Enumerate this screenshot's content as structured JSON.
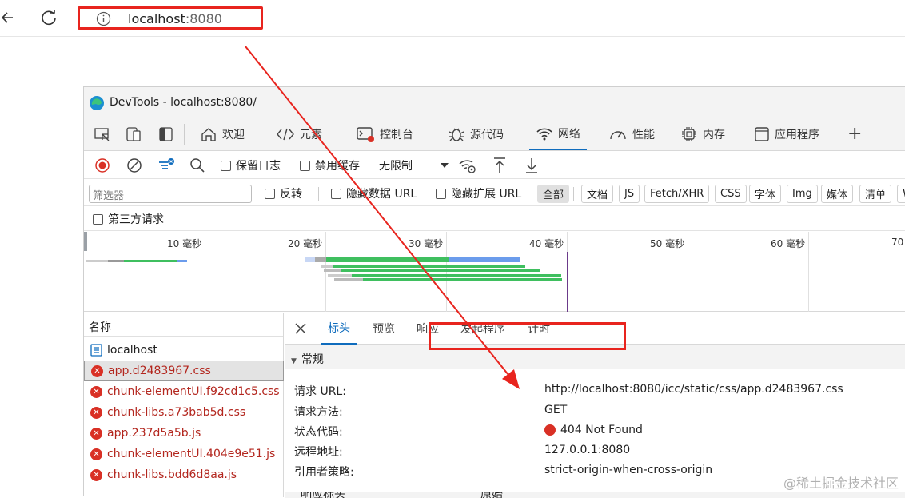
{
  "browser": {
    "address_host": "localhost",
    "address_port": ":8080",
    "back_icon": "arrow-left-icon",
    "reload_icon": "reload-icon",
    "info_icon": "info-icon",
    "highlight_color": "#e8241e"
  },
  "devtools": {
    "title": "DevTools - localhost:8080/",
    "tabs": [
      {
        "label": "欢迎",
        "icon": "home-icon"
      },
      {
        "label": "元素",
        "icon": "code-icon"
      },
      {
        "label": "控制台",
        "icon": "console-icon"
      },
      {
        "label": "源代码",
        "icon": "bug-icon"
      },
      {
        "label": "网络",
        "icon": "wifi-icon"
      },
      {
        "label": "性能",
        "icon": "gauge-icon"
      },
      {
        "label": "内存",
        "icon": "chip-icon"
      },
      {
        "label": "应用程序",
        "icon": "window-icon"
      }
    ],
    "add_tab": "+",
    "toolbar": {
      "preserve_log": "保留日志",
      "disable_cache": "禁用缓存",
      "throttling": "无限制"
    },
    "filter": {
      "placeholder": "筛选器",
      "invert": "反转",
      "hide_data_url": "隐藏数据 URL",
      "hide_ext_url": "隐藏扩展 URL",
      "types": [
        "全部",
        "文档",
        "JS",
        "Fetch/XHR",
        "CSS",
        "字体",
        "Img",
        "媒体",
        "清单",
        "W"
      ],
      "third_party": "第三方请求"
    },
    "timeline": {
      "ticks": [
        "10 毫秒",
        "20 毫秒",
        "30 毫秒",
        "40 毫秒",
        "50 毫秒",
        "60 毫秒",
        "70"
      ]
    },
    "name_pane": {
      "header": "名称",
      "requests": [
        {
          "name": "localhost",
          "status": "ok"
        },
        {
          "name": "app.d2483967.css",
          "status": "error"
        },
        {
          "name": "chunk-elementUI.f92cd1c5.css",
          "status": "error"
        },
        {
          "name": "chunk-libs.a73bab5d.css",
          "status": "error"
        },
        {
          "name": "app.237d5a5b.js",
          "status": "error"
        },
        {
          "name": "chunk-elementUI.404e9e51.js",
          "status": "error"
        },
        {
          "name": "chunk-libs.bdd6d8aa.js",
          "status": "error"
        }
      ]
    },
    "detail": {
      "tabs": [
        "标头",
        "预览",
        "响应",
        "发起程序",
        "计时"
      ],
      "section": "常规",
      "rows": [
        {
          "key": "请求 URL:",
          "value": "http://localhost:8080/icc/static/css/app.d2483967.css"
        },
        {
          "key": "请求方法:",
          "value": "GET"
        },
        {
          "key": "状态代码:",
          "value": "404 Not Found"
        },
        {
          "key": "远程地址:",
          "value": "127.0.0.1:8080"
        },
        {
          "key": "引用者策略:",
          "value": "strict-origin-when-cross-origin"
        }
      ],
      "next_section": "响应标头",
      "raw": "原始"
    }
  },
  "watermark": "@稀土掘金技术社区"
}
